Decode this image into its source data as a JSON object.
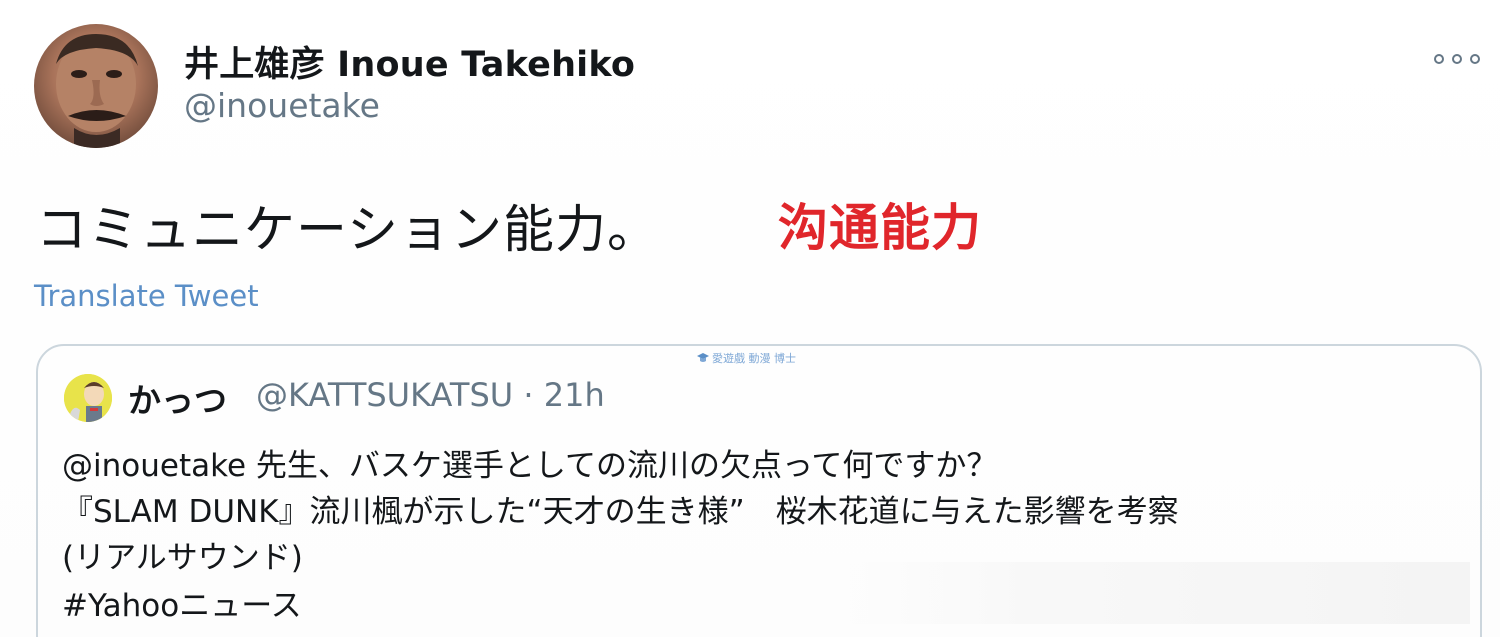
{
  "author": {
    "display_name": "井上雄彦 Inoue Takehiko",
    "handle": "@inouetake",
    "avatar_icon": "profile-photo"
  },
  "more_icon": "more-options-icon",
  "tweet": {
    "text": "コミュニケーション能力。",
    "translate_label": "Translate Tweet"
  },
  "overlay": {
    "label": "沟通能力",
    "color": "#e0262b"
  },
  "watermark": {
    "text": "愛遊戲 動漫 博士"
  },
  "quoted": {
    "display_name": "かっつ",
    "meta": "@KATTSUKATSU · 21h",
    "lines": [
      "@inouetake 先生、バスケ選手としての流川の欠点って何ですか？",
      "『SLAM DUNK』流川楓が示した“天才の生き様”　桜木花道に与えた影響を考察",
      "(リアルサウンド)",
      "#Yahooニュース"
    ]
  },
  "colors": {
    "link": "#5b8fc7",
    "secondary_text": "#657786",
    "card_border": "#ccd6dd"
  }
}
